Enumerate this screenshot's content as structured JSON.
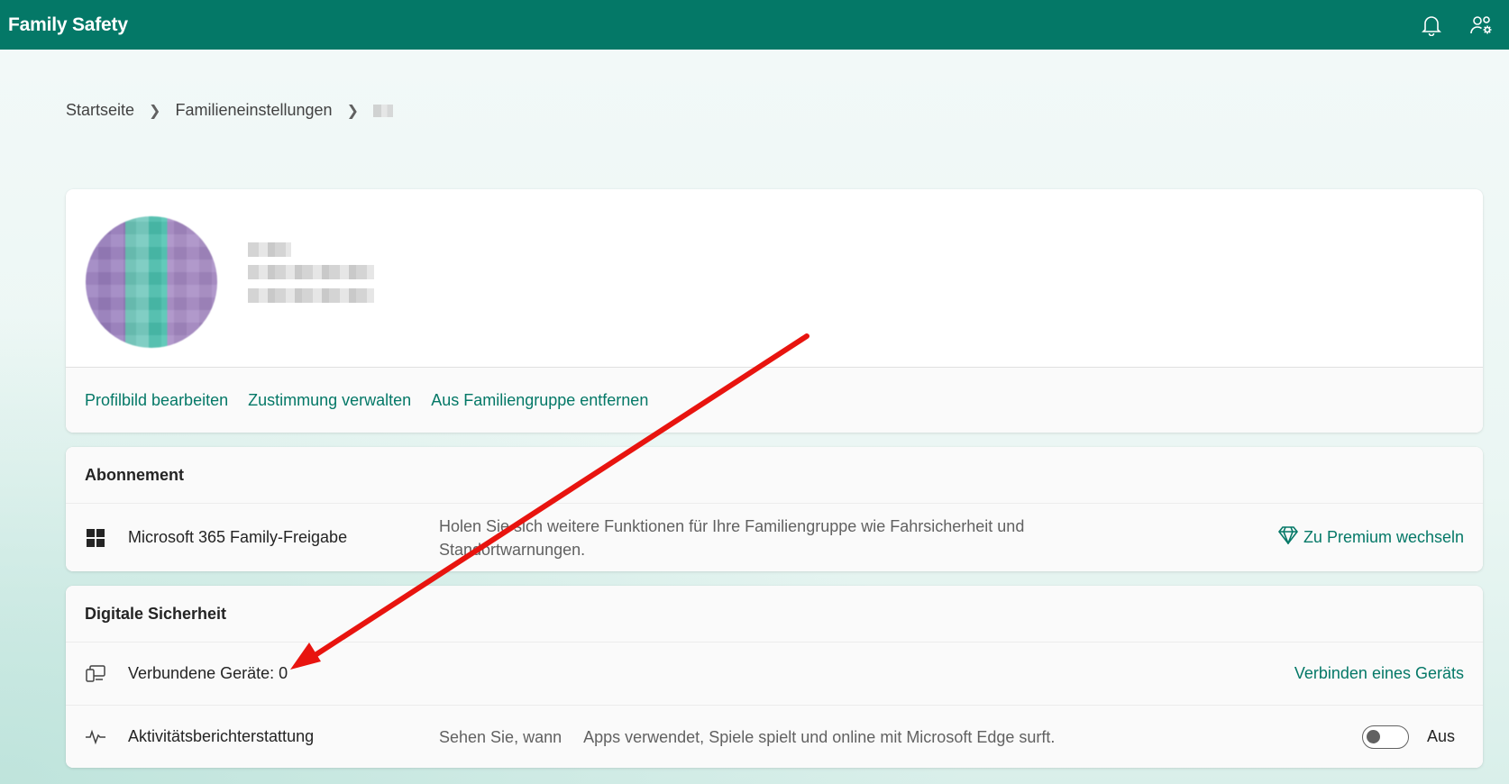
{
  "app": {
    "title": "Family Safety"
  },
  "header": {
    "icons": [
      "bell-icon",
      "people-settings-icon"
    ]
  },
  "breadcrumb": {
    "items": [
      "Startseite",
      "Familieneinstellungen"
    ]
  },
  "profile": {
    "links": [
      "Profilbild bearbeiten",
      "Zustimmung verwalten",
      "Aus Familiengruppe entfernen"
    ]
  },
  "subscription": {
    "header": "Abonnement",
    "row": {
      "title": "Microsoft 365 Family-Freigabe",
      "description": "Holen Sie sich weitere Funktionen für Ihre Familiengruppe wie Fahrsicherheit und Standortwarnungen.",
      "action": "Zu Premium wechseln"
    }
  },
  "safety": {
    "header": "Digitale Sicherheit",
    "devices": {
      "title": "Verbundene Geräte: 0",
      "action": "Verbinden eines Geräts"
    },
    "activity": {
      "title": "Aktivitätsberichterstattung",
      "description": "Sehen Sie, wann     Apps verwendet, Spiele spielt und online mit Microsoft Edge surft.",
      "toggle_state": "Aus"
    }
  },
  "colors": {
    "brand": "#047867",
    "annotation": "#e8140f"
  }
}
